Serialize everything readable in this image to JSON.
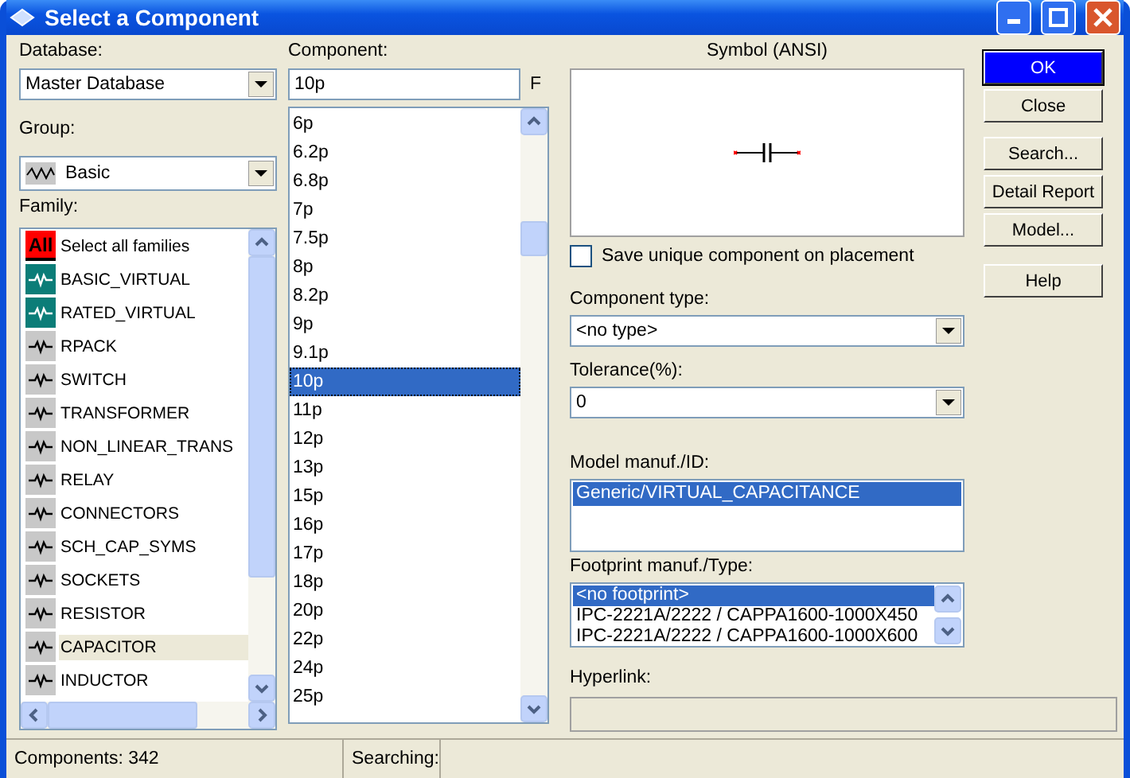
{
  "window": {
    "title": "Select a Component"
  },
  "database": {
    "label": "Database:",
    "value": "Master Database"
  },
  "group": {
    "label": "Group:",
    "value": "Basic"
  },
  "family": {
    "label": "Family:",
    "items": [
      {
        "label": "Select all families",
        "badge": "All",
        "selected": false
      },
      {
        "label": "BASIC_VIRTUAL",
        "selected": false
      },
      {
        "label": "RATED_VIRTUAL",
        "selected": false
      },
      {
        "label": "RPACK",
        "selected": false
      },
      {
        "label": "SWITCH",
        "selected": false
      },
      {
        "label": "TRANSFORMER",
        "selected": false
      },
      {
        "label": "NON_LINEAR_TRANS",
        "selected": false
      },
      {
        "label": "RELAY",
        "selected": false
      },
      {
        "label": "CONNECTORS",
        "selected": false
      },
      {
        "label": "SCH_CAP_SYMS",
        "selected": false
      },
      {
        "label": "SOCKETS",
        "selected": false
      },
      {
        "label": "RESISTOR",
        "selected": false
      },
      {
        "label": "CAPACITOR",
        "selected": true
      },
      {
        "label": "INDUCTOR",
        "selected": false
      }
    ]
  },
  "component": {
    "label": "Component:",
    "value": "10p",
    "unit": "F",
    "items": [
      {
        "label": "6p",
        "selected": false
      },
      {
        "label": "6.2p",
        "selected": false
      },
      {
        "label": "6.8p",
        "selected": false
      },
      {
        "label": "7p",
        "selected": false
      },
      {
        "label": "7.5p",
        "selected": false
      },
      {
        "label": "8p",
        "selected": false
      },
      {
        "label": "8.2p",
        "selected": false
      },
      {
        "label": "9p",
        "selected": false
      },
      {
        "label": "9.1p",
        "selected": false
      },
      {
        "label": "10p",
        "selected": true
      },
      {
        "label": "11p",
        "selected": false
      },
      {
        "label": "12p",
        "selected": false
      },
      {
        "label": "13p",
        "selected": false
      },
      {
        "label": "15p",
        "selected": false
      },
      {
        "label": "16p",
        "selected": false
      },
      {
        "label": "17p",
        "selected": false
      },
      {
        "label": "18p",
        "selected": false
      },
      {
        "label": "20p",
        "selected": false
      },
      {
        "label": "22p",
        "selected": false
      },
      {
        "label": "24p",
        "selected": false
      },
      {
        "label": "25p",
        "selected": false
      }
    ]
  },
  "symbol": {
    "label": "Symbol (ANSI)"
  },
  "save_unique": {
    "label": "Save unique component on placement",
    "checked": false
  },
  "component_type": {
    "label": "Component type:",
    "value": "<no type>"
  },
  "tolerance": {
    "label": "Tolerance(%):",
    "value": "0"
  },
  "model": {
    "label": "Model manuf./ID:",
    "items": [
      {
        "label": "Generic/VIRTUAL_CAPACITANCE",
        "selected": true
      }
    ]
  },
  "footprint": {
    "label": "Footprint manuf./Type:",
    "items": [
      {
        "label": "<no footprint>",
        "selected": true
      },
      {
        "label": "IPC-2221A/2222 / CAPPA1600-1000X450",
        "selected": false
      },
      {
        "label": "IPC-2221A/2222 / CAPPA1600-1000X600",
        "selected": false
      }
    ]
  },
  "hyperlink": {
    "label": "Hyperlink:"
  },
  "buttons": [
    {
      "label": "OK",
      "default": true
    },
    {
      "label": "Close",
      "default": false
    },
    {
      "label": "Search...",
      "default": false
    },
    {
      "label": "Detail Report",
      "default": false
    },
    {
      "label": "Model...",
      "default": false
    },
    {
      "label": "Help",
      "default": false
    }
  ],
  "status_bar": [
    "Components: 342",
    "Searching:"
  ]
}
